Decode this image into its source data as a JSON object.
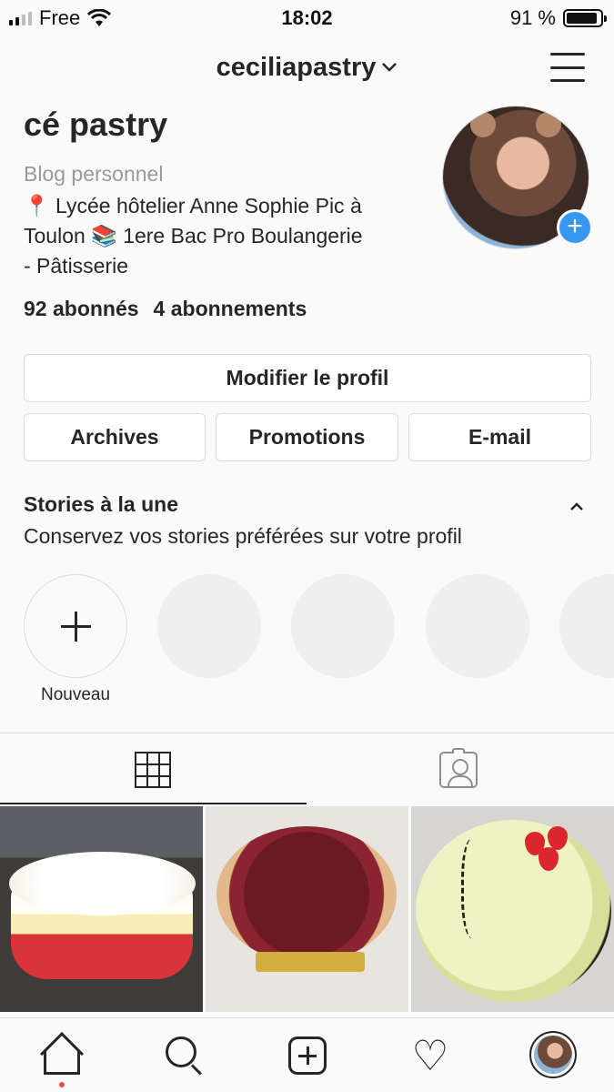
{
  "status_bar": {
    "carrier": "Free",
    "time": "18:02",
    "battery_text": "91 %",
    "battery_level": 0.91
  },
  "header": {
    "username": "ceciliapastry",
    "chevron": "⌄"
  },
  "profile": {
    "display_name": "cé pastry",
    "category": "Blog personnel",
    "bio_line1": "📍 Lycée hôtelier Anne Sophie Pic à",
    "bio_line2": "Toulon 📚 1ere Bac Pro Boulangerie",
    "bio_line3": "- Pâtisserie",
    "followers": "92 abonnés",
    "following": "4 abonnements"
  },
  "buttons": {
    "edit_profile": "Modifier le profil",
    "archives": "Archives",
    "promotions": "Promotions",
    "email": "E-mail"
  },
  "stories": {
    "title": "Stories à la une",
    "subtitle": "Conservez vos stories préférées sur votre profil",
    "new_label": "Nouveau",
    "caret": "^"
  },
  "icons": {
    "heart": "♡",
    "plus": "+"
  },
  "colors": {
    "accent": "#3897f0",
    "notification": "#ed4956"
  }
}
